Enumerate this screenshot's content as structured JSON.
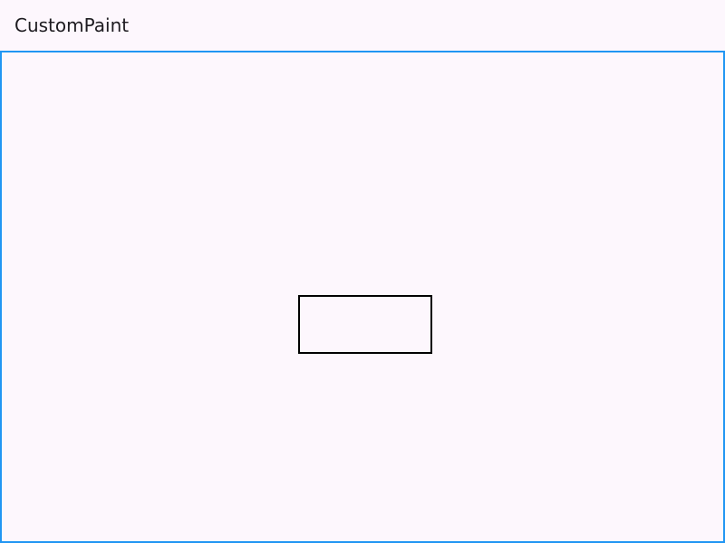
{
  "app_bar": {
    "title": "CustomPaint"
  },
  "colors": {
    "background": "#fdf7fd",
    "canvas_border": "#2196f3",
    "shape_stroke": "#000000",
    "title_text": "#1d1b20"
  }
}
